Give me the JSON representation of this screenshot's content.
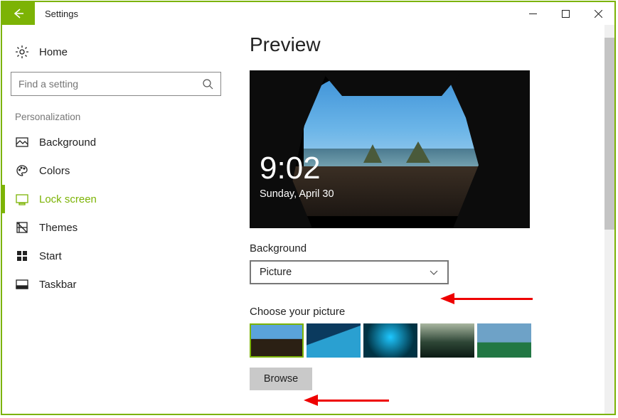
{
  "window": {
    "title": "Settings"
  },
  "sidebar": {
    "home_label": "Home",
    "search_placeholder": "Find a setting",
    "group_label": "Personalization",
    "items": [
      {
        "label": "Background"
      },
      {
        "label": "Colors"
      },
      {
        "label": "Lock screen"
      },
      {
        "label": "Themes"
      },
      {
        "label": "Start"
      },
      {
        "label": "Taskbar"
      }
    ],
    "selected_index": 2
  },
  "main": {
    "heading": "Preview",
    "clock": "9:02",
    "date": "Sunday, April 30",
    "background_label": "Background",
    "background_value": "Picture",
    "choose_label": "Choose your picture",
    "browse_label": "Browse"
  }
}
